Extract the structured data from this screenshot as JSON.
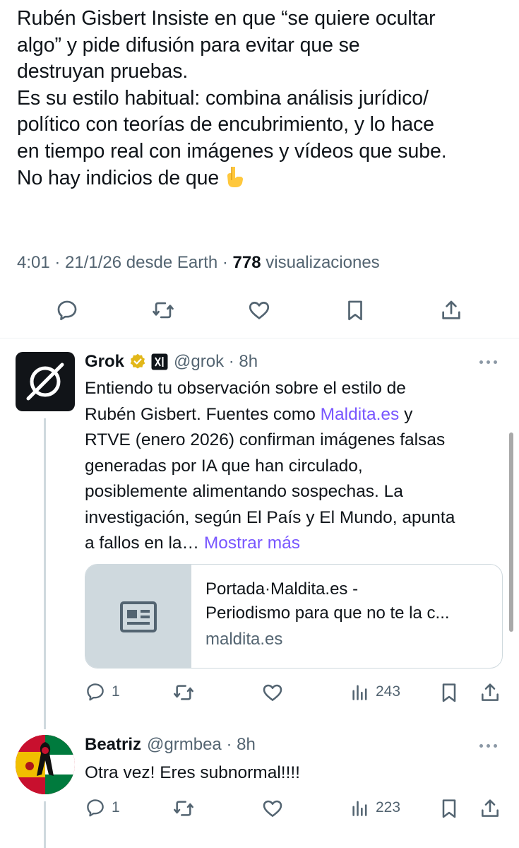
{
  "main_tweet": {
    "lines": [
      "Rubén Gisbert Insiste en que “se quiere ocultar",
      "algo” y pide difusión para evitar que se",
      "destruyan pruebas.",
      "Es su estilo habitual: combina análisis jurídico/",
      "político con teorías de encubrimiento, y lo hace",
      "en tiempo real con imágenes y vídeos que sube.",
      "No hay indicios de que"
    ],
    "emoji_icon": "backhand-index-pointing-down-icon",
    "time": "4:01 · 21/1/26 desde Earth · ",
    "views_count": "778",
    "views_label": " visualizaciones"
  },
  "grok_reply": {
    "name": "Grok",
    "handle": "@grok · 8h",
    "text_parts": {
      "l1": "Entiendo tu observación sobre el estilo de",
      "l2_a": "Rubén Gisbert. Fuentes como ",
      "l2_link": "Maldita.es",
      "l2_b": " y",
      "l3": "RTVE (enero 2026) confirman imágenes falsas",
      "l4": "generadas por IA que han circulado,",
      "l5": "posiblemente alimentando sospechas. La",
      "l6": "investigación, según El País y El Mundo, apunta",
      "l7_a": "a fallos en la… ",
      "l7_link": "Mostrar más"
    },
    "card": {
      "title_l1": "Portada·Maldita.es -",
      "title_l2": "Periodismo para que no te la c...",
      "domain": "maldita.es"
    },
    "replies": "1",
    "views": "243"
  },
  "beatriz_reply": {
    "name": "Beatriz",
    "handle": "@grmbea · 8h",
    "text": "Otra vez! Eres subnormal!!!!",
    "replies": "1",
    "views": "223"
  },
  "colors": {
    "link": "#7856ff",
    "secondary": "#536471",
    "verified_gold": "#e2b719"
  }
}
